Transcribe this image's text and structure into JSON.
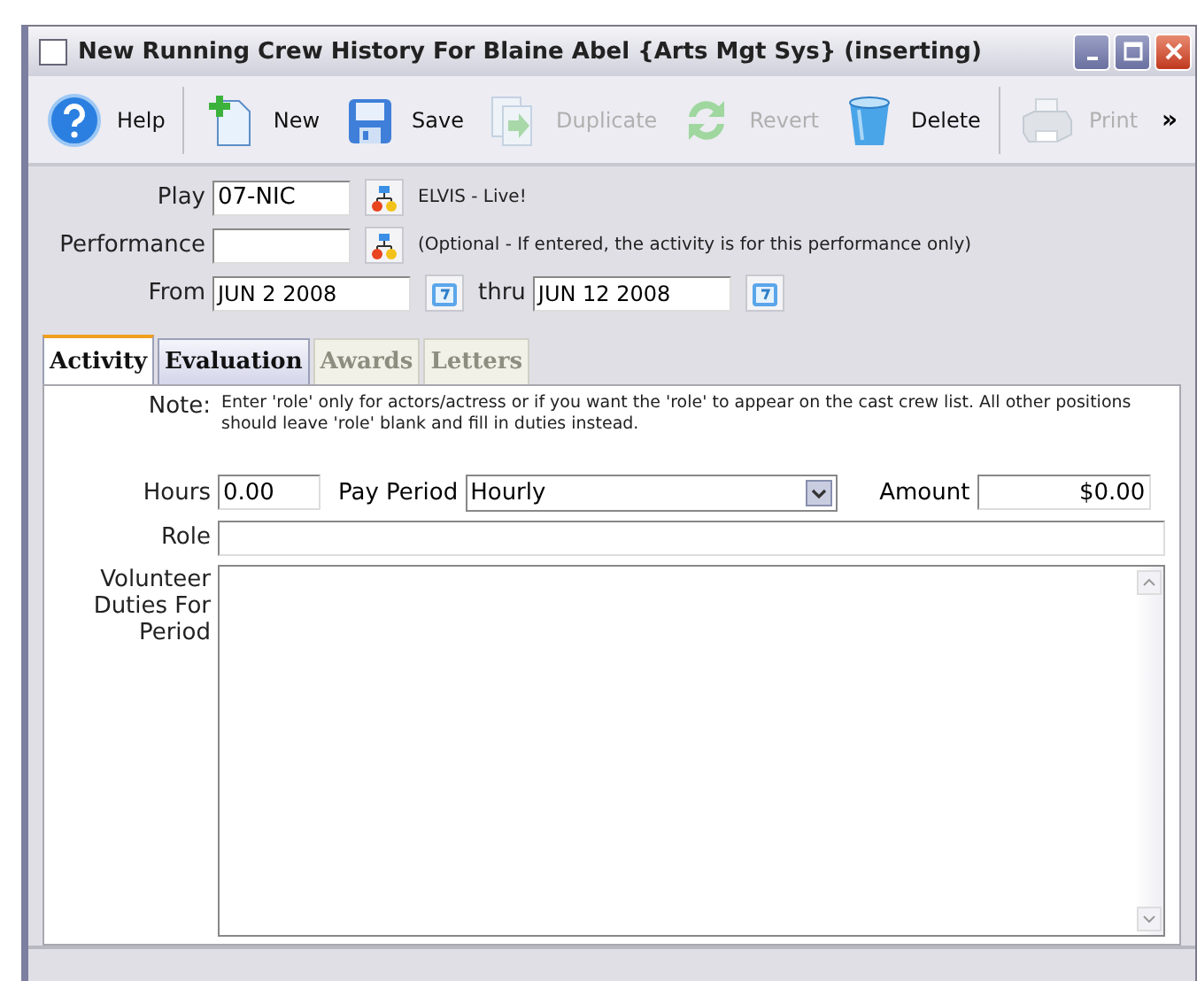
{
  "window": {
    "title": "New Running Crew History For Blaine Abel {Arts Mgt Sys} (inserting)"
  },
  "toolbar": [
    {
      "kind": "help",
      "label": "Help",
      "disabled": false
    },
    {
      "kind": "new",
      "label": "New",
      "disabled": false
    },
    {
      "kind": "save",
      "label": "Save",
      "disabled": false
    },
    {
      "kind": "duplicate",
      "label": "Duplicate",
      "disabled": true
    },
    {
      "kind": "revert",
      "label": "Revert",
      "disabled": true
    },
    {
      "kind": "delete",
      "label": "Delete",
      "disabled": false
    },
    {
      "kind": "print",
      "label": "Print",
      "disabled": true
    }
  ],
  "toolbar_more": "»",
  "header": {
    "play": {
      "label": "Play",
      "value": "07-NIC",
      "description": "ELVIS - Live!"
    },
    "performance": {
      "label": "Performance",
      "hint": "(Optional - If entered, the activity is for this performance only)"
    },
    "from": {
      "label": "From",
      "value": "JUN 2 2008"
    },
    "thru": {
      "label": "thru",
      "value": "JUN 12 2008"
    }
  },
  "tabs": [
    {
      "label": "Activity",
      "selected": true,
      "disabled": false
    },
    {
      "label": "Evaluation",
      "selected": false,
      "disabled": false
    },
    {
      "label": "Awards",
      "selected": false,
      "disabled": true
    },
    {
      "label": "Letters",
      "selected": false,
      "disabled": true
    }
  ],
  "activity": {
    "note_label": "Note:",
    "note": "Enter 'role' only for actors/actress or if you want the 'role' to appear on the cast crew list.  All other positions should leave 'role' blank and fill in duties instead.",
    "hours": {
      "label": "Hours",
      "value": "0.00"
    },
    "pay_period": {
      "label": "Pay Period",
      "value": "Hourly"
    },
    "amount": {
      "label": "Amount",
      "value": "$0.00"
    },
    "role": {
      "label": "Role"
    },
    "duties": {
      "label": "Volunteer Duties For Period"
    }
  }
}
